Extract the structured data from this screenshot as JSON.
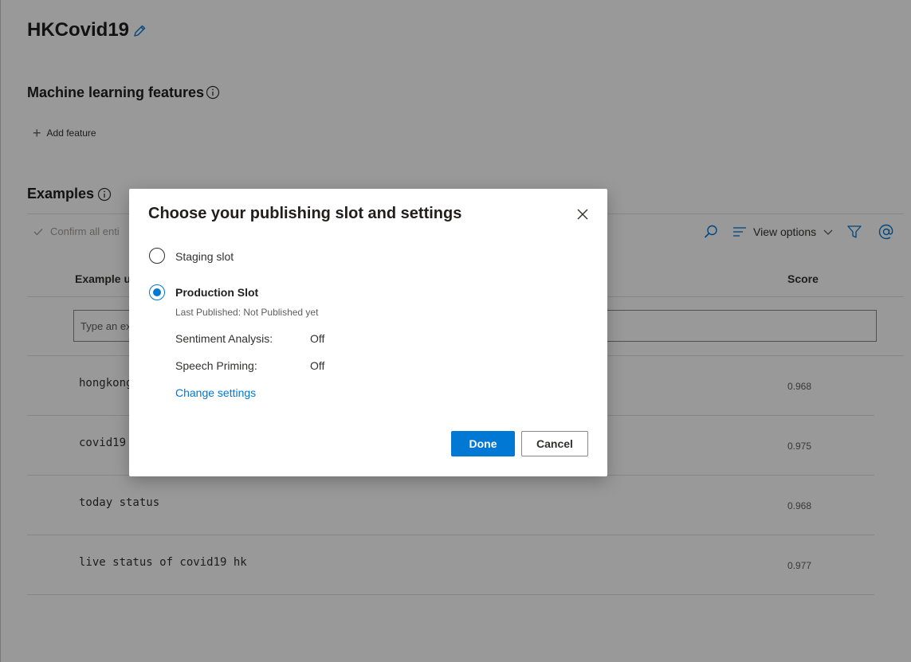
{
  "page": {
    "title": "HKCovid19",
    "ml_features_heading": "Machine learning features",
    "add_feature_label": "Add feature",
    "examples_heading": "Examples",
    "toolbar": {
      "confirm_all_label": "Confirm all enti",
      "view_options_label": "View options"
    },
    "columns": {
      "example": "Example us",
      "score": "Score"
    },
    "input_placeholder": "Type an ex",
    "rows": [
      {
        "text": "hongkong",
        "score": "0.968"
      },
      {
        "text": "covid19",
        "score": "0.975"
      },
      {
        "text": "today status",
        "score": "0.968"
      },
      {
        "text": "live status of covid19 hk",
        "score": "0.977"
      }
    ]
  },
  "dialog": {
    "title": "Choose your publishing slot and settings",
    "staging_label": "Staging slot",
    "production_label": "Production Slot",
    "last_published": "Last Published: Not Published yet",
    "settings": [
      {
        "name": "Sentiment Analysis:",
        "value": "Off"
      },
      {
        "name": "Speech Priming:",
        "value": "Off"
      }
    ],
    "change_settings_link": "Change settings",
    "done_label": "Done",
    "cancel_label": "Cancel",
    "selected_slot": "production"
  },
  "colors": {
    "accent": "#0078d4",
    "overlay": "rgba(0,0,0,0.4)"
  }
}
